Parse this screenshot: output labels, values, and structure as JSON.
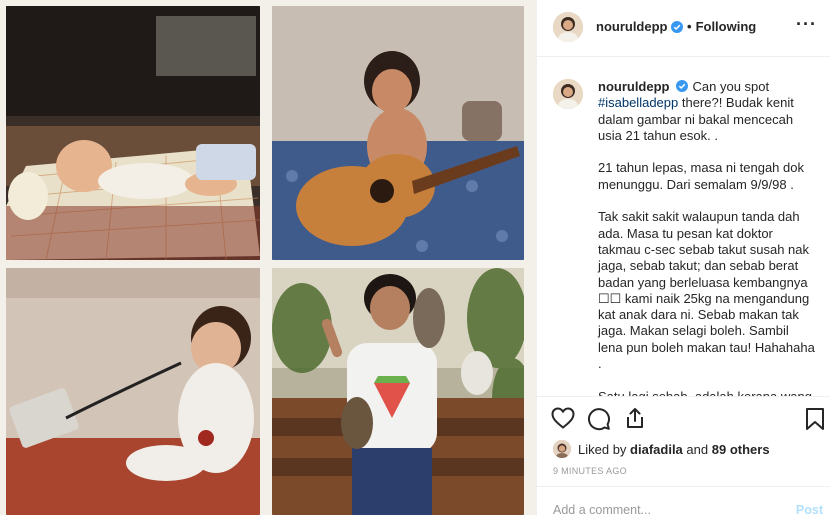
{
  "colors": {
    "link": "#003569",
    "verified": "#3897f0",
    "muted": "#999999",
    "post_button": "#b2dffc"
  },
  "header": {
    "username": "nouruldepp",
    "following_label": "Following",
    "more_icon": "more-options-icon"
  },
  "caption": {
    "username": "nouruldepp",
    "text_intro": "Can you spot",
    "hashtag": "#isabelladepp",
    "text_body": " there?! Budak kenit dalam gambar ni bakal mencecah usia 21 tahun esok. .\n\n21 tahun lepas, masa ni tengah dok menunggu. Dari semalam 9/9/98 .\n\nTak sakit sakit walaupun tanda dah ada. Masa tu pesan kat doktor takmau c-sec sebab takut susah nak jaga, sebab takut; dan sebab berat badan yang berleluasa kembangnya ☐☐ kami naik 25kg na mengandung kat anak dara ni. Sebab makan tak jaga. Makan selagi boleh. Sambil lena pun boleh makan tau! Hahahaha .\n\nSatu lagi sebab, adalah kerana wang"
  },
  "actions": {
    "like_icon": "heart-icon",
    "comment_icon": "comment-icon",
    "share_icon": "share-icon",
    "save_icon": "bookmark-icon"
  },
  "likes": {
    "prefix": "Liked by",
    "user": "diafadila",
    "conjunction": "and",
    "others": "89 others"
  },
  "timestamp": "9 MINUTES AGO",
  "comment_box": {
    "placeholder": "Add a comment...",
    "post_label": "Post"
  }
}
